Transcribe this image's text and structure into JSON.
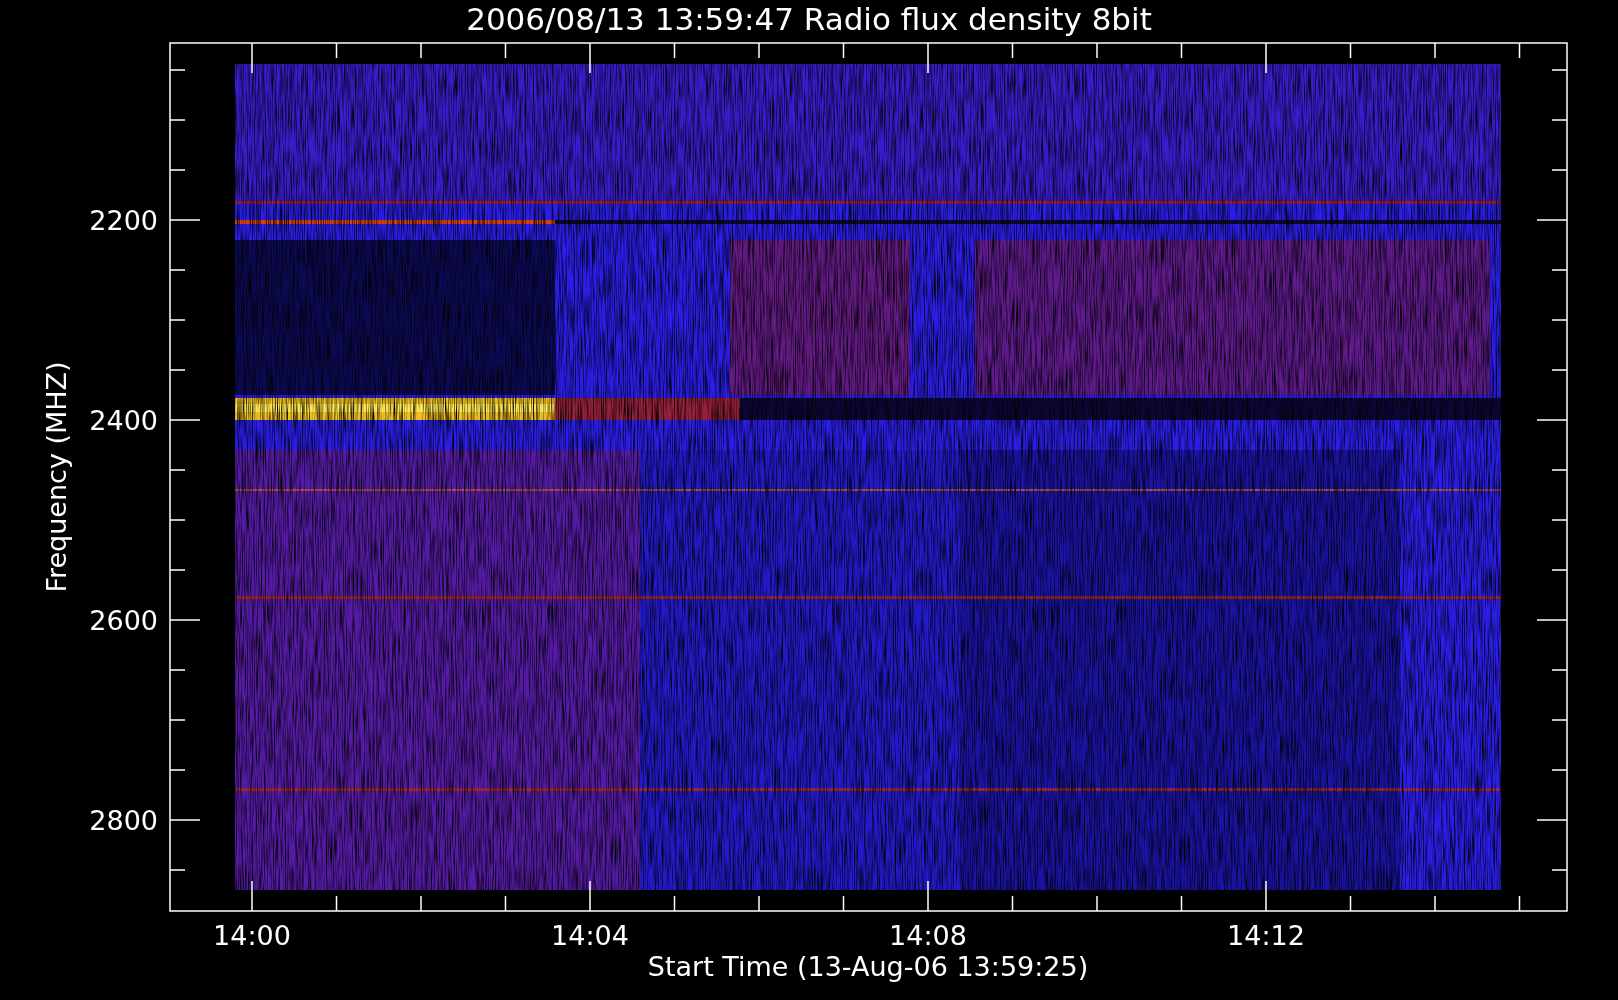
{
  "title": "2006/08/13 13:59:47 Radio flux density 8bit",
  "y_axis": {
    "label": "Frequency (MHZ)",
    "tick_labels": [
      "2200",
      "2400",
      "2600",
      "2800"
    ]
  },
  "x_axis": {
    "label": "Start Time (13-Aug-06 13:59:25)",
    "tick_labels": [
      "14:00",
      "14:04",
      "14:08",
      "14:12"
    ]
  }
}
